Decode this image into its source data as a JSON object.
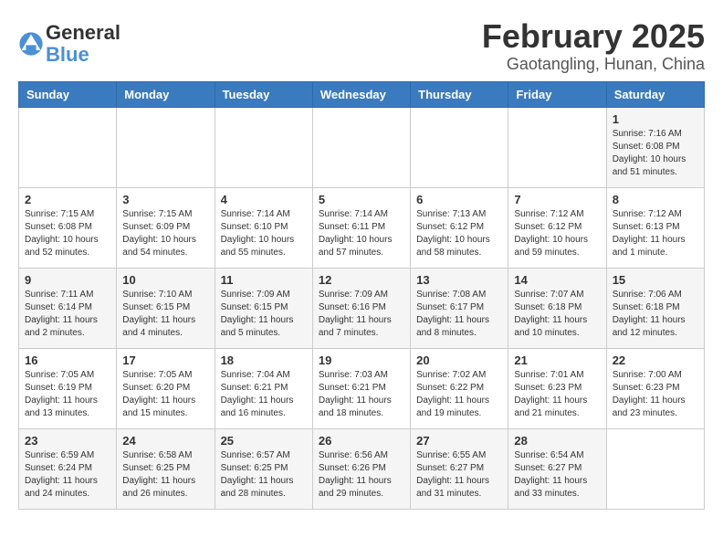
{
  "header": {
    "logo_general": "General",
    "logo_blue": "Blue",
    "title": "February 2025",
    "subtitle": "Gaotangling, Hunan, China"
  },
  "weekdays": [
    "Sunday",
    "Monday",
    "Tuesday",
    "Wednesday",
    "Thursday",
    "Friday",
    "Saturday"
  ],
  "weeks": [
    [
      {
        "day": "",
        "info": ""
      },
      {
        "day": "",
        "info": ""
      },
      {
        "day": "",
        "info": ""
      },
      {
        "day": "",
        "info": ""
      },
      {
        "day": "",
        "info": ""
      },
      {
        "day": "",
        "info": ""
      },
      {
        "day": "1",
        "info": "Sunrise: 7:16 AM\nSunset: 6:08 PM\nDaylight: 10 hours and 51 minutes."
      }
    ],
    [
      {
        "day": "2",
        "info": "Sunrise: 7:15 AM\nSunset: 6:08 PM\nDaylight: 10 hours and 52 minutes."
      },
      {
        "day": "3",
        "info": "Sunrise: 7:15 AM\nSunset: 6:09 PM\nDaylight: 10 hours and 54 minutes."
      },
      {
        "day": "4",
        "info": "Sunrise: 7:14 AM\nSunset: 6:10 PM\nDaylight: 10 hours and 55 minutes."
      },
      {
        "day": "5",
        "info": "Sunrise: 7:14 AM\nSunset: 6:11 PM\nDaylight: 10 hours and 57 minutes."
      },
      {
        "day": "6",
        "info": "Sunrise: 7:13 AM\nSunset: 6:12 PM\nDaylight: 10 hours and 58 minutes."
      },
      {
        "day": "7",
        "info": "Sunrise: 7:12 AM\nSunset: 6:12 PM\nDaylight: 10 hours and 59 minutes."
      },
      {
        "day": "8",
        "info": "Sunrise: 7:12 AM\nSunset: 6:13 PM\nDaylight: 11 hours and 1 minute."
      }
    ],
    [
      {
        "day": "9",
        "info": "Sunrise: 7:11 AM\nSunset: 6:14 PM\nDaylight: 11 hours and 2 minutes."
      },
      {
        "day": "10",
        "info": "Sunrise: 7:10 AM\nSunset: 6:15 PM\nDaylight: 11 hours and 4 minutes."
      },
      {
        "day": "11",
        "info": "Sunrise: 7:09 AM\nSunset: 6:15 PM\nDaylight: 11 hours and 5 minutes."
      },
      {
        "day": "12",
        "info": "Sunrise: 7:09 AM\nSunset: 6:16 PM\nDaylight: 11 hours and 7 minutes."
      },
      {
        "day": "13",
        "info": "Sunrise: 7:08 AM\nSunset: 6:17 PM\nDaylight: 11 hours and 8 minutes."
      },
      {
        "day": "14",
        "info": "Sunrise: 7:07 AM\nSunset: 6:18 PM\nDaylight: 11 hours and 10 minutes."
      },
      {
        "day": "15",
        "info": "Sunrise: 7:06 AM\nSunset: 6:18 PM\nDaylight: 11 hours and 12 minutes."
      }
    ],
    [
      {
        "day": "16",
        "info": "Sunrise: 7:05 AM\nSunset: 6:19 PM\nDaylight: 11 hours and 13 minutes."
      },
      {
        "day": "17",
        "info": "Sunrise: 7:05 AM\nSunset: 6:20 PM\nDaylight: 11 hours and 15 minutes."
      },
      {
        "day": "18",
        "info": "Sunrise: 7:04 AM\nSunset: 6:21 PM\nDaylight: 11 hours and 16 minutes."
      },
      {
        "day": "19",
        "info": "Sunrise: 7:03 AM\nSunset: 6:21 PM\nDaylight: 11 hours and 18 minutes."
      },
      {
        "day": "20",
        "info": "Sunrise: 7:02 AM\nSunset: 6:22 PM\nDaylight: 11 hours and 19 minutes."
      },
      {
        "day": "21",
        "info": "Sunrise: 7:01 AM\nSunset: 6:23 PM\nDaylight: 11 hours and 21 minutes."
      },
      {
        "day": "22",
        "info": "Sunrise: 7:00 AM\nSunset: 6:23 PM\nDaylight: 11 hours and 23 minutes."
      }
    ],
    [
      {
        "day": "23",
        "info": "Sunrise: 6:59 AM\nSunset: 6:24 PM\nDaylight: 11 hours and 24 minutes."
      },
      {
        "day": "24",
        "info": "Sunrise: 6:58 AM\nSunset: 6:25 PM\nDaylight: 11 hours and 26 minutes."
      },
      {
        "day": "25",
        "info": "Sunrise: 6:57 AM\nSunset: 6:25 PM\nDaylight: 11 hours and 28 minutes."
      },
      {
        "day": "26",
        "info": "Sunrise: 6:56 AM\nSunset: 6:26 PM\nDaylight: 11 hours and 29 minutes."
      },
      {
        "day": "27",
        "info": "Sunrise: 6:55 AM\nSunset: 6:27 PM\nDaylight: 11 hours and 31 minutes."
      },
      {
        "day": "28",
        "info": "Sunrise: 6:54 AM\nSunset: 6:27 PM\nDaylight: 11 hours and 33 minutes."
      },
      {
        "day": "",
        "info": ""
      }
    ]
  ]
}
